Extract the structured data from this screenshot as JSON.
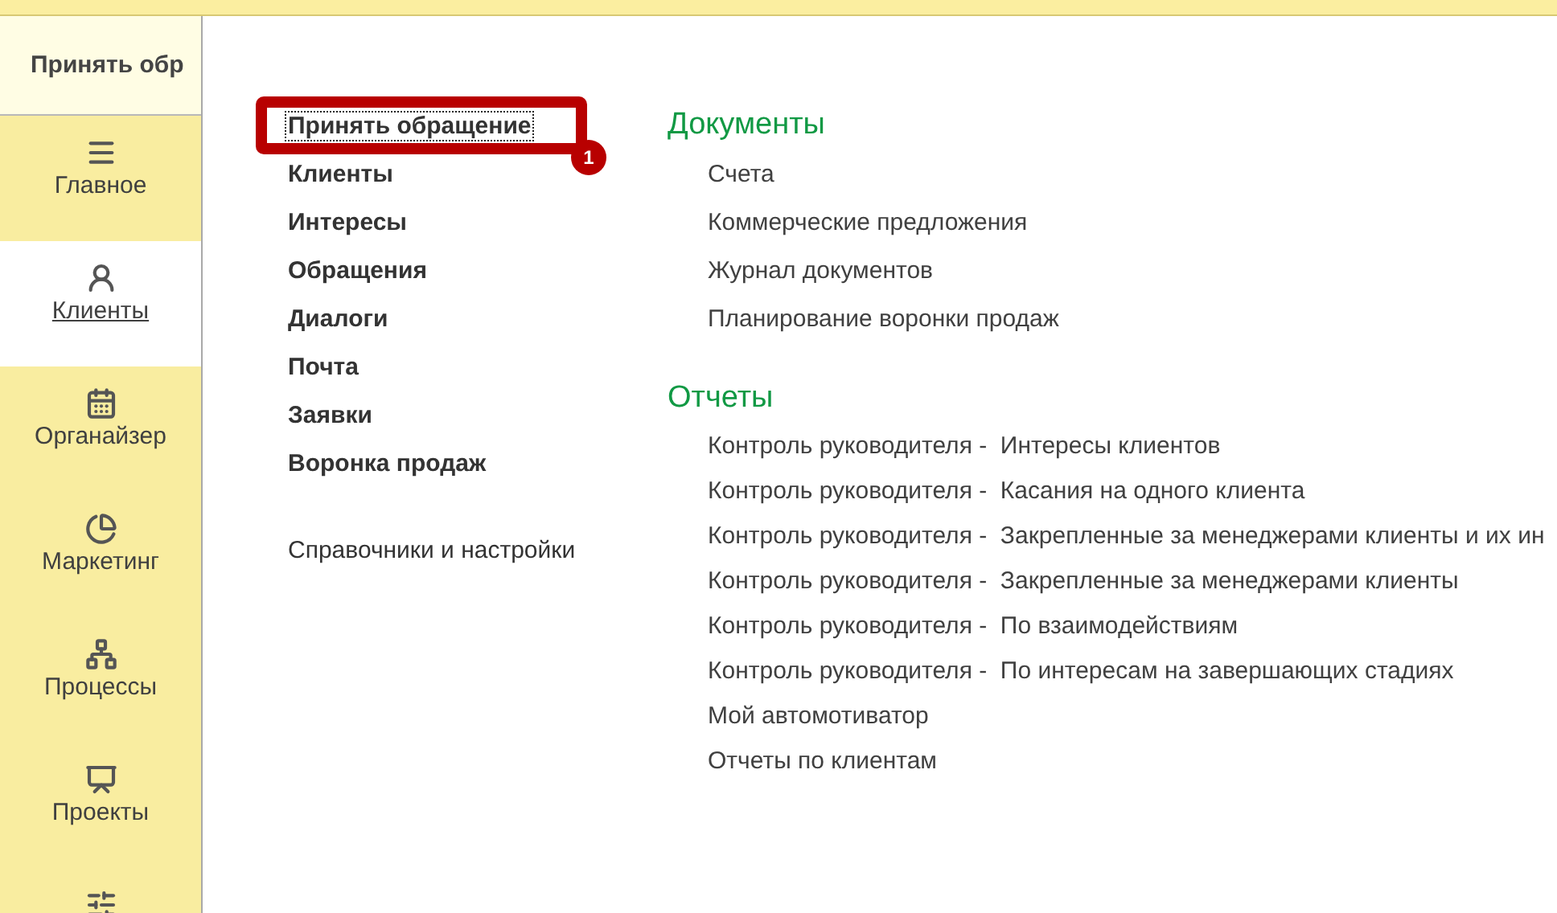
{
  "tab_title": "Принять обр",
  "sidebar": {
    "items": [
      {
        "kind": "menu",
        "label": "Главное",
        "selected": false
      },
      {
        "kind": "clients",
        "label": "Клиенты",
        "selected": true
      },
      {
        "kind": "calendar",
        "label": "Органайзер",
        "selected": false
      },
      {
        "kind": "pie",
        "label": "Маркетинг",
        "selected": false
      },
      {
        "kind": "tree",
        "label": "Процессы",
        "selected": false
      },
      {
        "kind": "chart",
        "label": "Проекты",
        "selected": false
      },
      {
        "kind": "sliders",
        "selected": false
      }
    ]
  },
  "commands": [
    {
      "kind": "command",
      "label": "Принять обращение",
      "focused": true,
      "highlighted": true
    },
    {
      "kind": "command",
      "label": "Клиенты",
      "focused": false
    },
    {
      "kind": "command",
      "label": "Интересы",
      "focused": false
    },
    {
      "kind": "command",
      "label": "Обращения",
      "focused": false
    },
    {
      "kind": "command",
      "label": "Диалоги",
      "focused": false
    },
    {
      "kind": "command",
      "label": "Почта",
      "focused": false
    },
    {
      "kind": "command",
      "label": "Заявки",
      "focused": false
    },
    {
      "kind": "command",
      "label": "Воронка продаж",
      "focused": false
    },
    {
      "kind": "link",
      "label": "Справочники и настройки",
      "focused": false
    }
  ],
  "annotation": {
    "badge": "1"
  },
  "sections": [
    {
      "title": "Документы",
      "items": [
        "Счета",
        "Коммерческие предложения",
        "Журнал документов",
        "Планирование воронки продаж"
      ]
    },
    {
      "title": "Отчеты",
      "items": [
        "Контроль руководителя -  Интересы клиентов",
        "Контроль руководителя -  Касания на одного клиента",
        "Контроль руководителя -  Закрепленные за менеджерами клиенты и их ин",
        "Контроль руководителя -  Закрепленные за менеджерами клиенты",
        "Контроль руководителя -  По взаимодействиям",
        "Контроль руководителя -  По интересам на завершающих стадиях",
        "Мой автомотиватор",
        "Отчеты по клиентам"
      ]
    }
  ]
}
